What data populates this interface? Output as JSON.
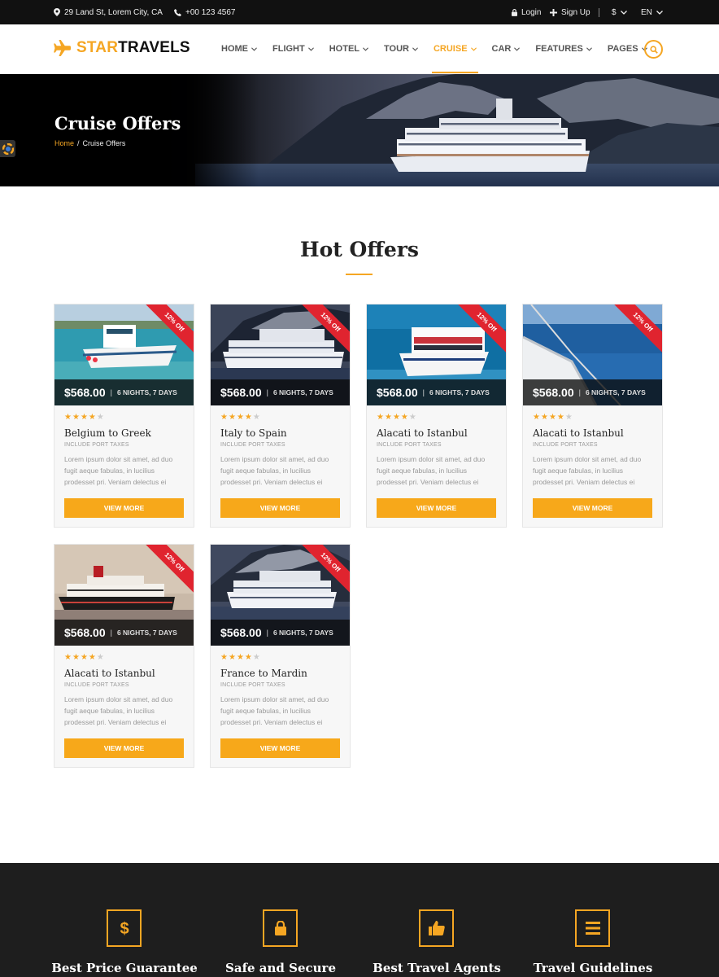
{
  "topbar": {
    "address": "29 Land St, Lorem City, CA",
    "phone": "+00 123 4567",
    "login": "Login",
    "signup": "Sign Up",
    "currency": "$",
    "language": "EN"
  },
  "header": {
    "logo_part1": "STAR",
    "logo_part2": "TRAVELS",
    "nav": [
      "HOME",
      "FLIGHT",
      "HOTEL",
      "TOUR",
      "CRUISE",
      "CAR",
      "FEATURES",
      "PAGES"
    ],
    "active_nav": "CRUISE"
  },
  "hero": {
    "title": "Cruise Offers",
    "breadcrumb_home": "Home",
    "breadcrumb_sep": "/",
    "breadcrumb_current": "Cruise Offers"
  },
  "offers": {
    "title": "Hot Offers",
    "items": [
      {
        "name": "Belgium to Greek",
        "price": "$568.00",
        "duration": "6 NIGHTS, 7 DAYS",
        "badge": "12% Off",
        "rating": 4,
        "sub": "INCLUDE PORT TAXES",
        "desc": "Lorem ipsum dolor sit amet, ad duo fugit aeque fabulas, in lucilius prodesset pri. Veniam delectus ei",
        "button": "VIEW MORE"
      },
      {
        "name": "Italy to Spain",
        "price": "$568.00",
        "duration": "6 NIGHTS, 7 DAYS",
        "badge": "12% Off",
        "rating": 4,
        "sub": "INCLUDE PORT TAXES",
        "desc": "Lorem ipsum dolor sit amet, ad duo fugit aeque fabulas, in lucilius prodesset pri. Veniam delectus ei",
        "button": "VIEW MORE"
      },
      {
        "name": "Alacati to Istanbul",
        "price": "$568.00",
        "duration": "6 NIGHTS, 7 DAYS",
        "badge": "12% Off",
        "rating": 4,
        "sub": "INCLUDE PORT TAXES",
        "desc": "Lorem ipsum dolor sit amet, ad duo fugit aeque fabulas, in lucilius prodesset pri. Veniam delectus ei",
        "button": "VIEW MORE"
      },
      {
        "name": "Alacati to Istanbul",
        "price": "$568.00",
        "duration": "6 NIGHTS, 7 DAYS",
        "badge": "12% Off",
        "rating": 4,
        "sub": "INCLUDE PORT TAXES",
        "desc": "Lorem ipsum dolor sit amet, ad duo fugit aeque fabulas, in lucilius prodesset pri. Veniam delectus ei",
        "button": "VIEW MORE"
      },
      {
        "name": "Alacati to Istanbul",
        "price": "$568.00",
        "duration": "6 NIGHTS, 7 DAYS",
        "badge": "12% Off",
        "rating": 4,
        "sub": "INCLUDE PORT TAXES",
        "desc": "Lorem ipsum dolor sit amet, ad duo fugit aeque fabulas, in lucilius prodesset pri. Veniam delectus ei",
        "button": "VIEW MORE"
      },
      {
        "name": "France to Mardin",
        "price": "$568.00",
        "duration": "6 NIGHTS, 7 DAYS",
        "badge": "12% Off",
        "rating": 4,
        "sub": "INCLUDE PORT TAXES",
        "desc": "Lorem ipsum dolor sit amet, ad duo fugit aeque fabulas, in lucilius prodesset pri. Veniam delectus ei",
        "button": "VIEW MORE"
      }
    ]
  },
  "features": [
    {
      "label": "Best Price Guarantee",
      "icon": "dollar-icon"
    },
    {
      "label": "Safe and Secure",
      "icon": "lock-icon"
    },
    {
      "label": "Best Travel Agents",
      "icon": "thumbs-up-icon"
    },
    {
      "label": "Travel Guidelines",
      "icon": "menu-icon"
    }
  ],
  "colors": {
    "accent": "#f5a623",
    "badge": "#e0242f",
    "dark": "#1e1e1e"
  }
}
